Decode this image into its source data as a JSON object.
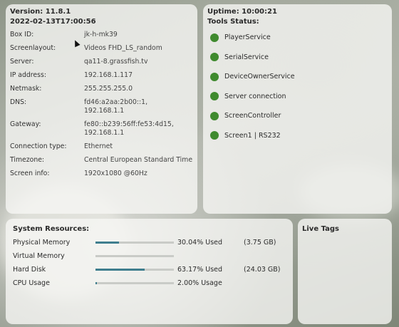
{
  "info": {
    "version": "Version: 11.8.1",
    "timestamp": "2022-02-13T17:00:56",
    "rows": [
      {
        "key": "Box ID:",
        "value": "jk-h-mk39"
      },
      {
        "key": "Screenlayout:",
        "value": "Videos FHD_LS_random"
      },
      {
        "key": "Server:",
        "value": "qa11-8.grassfish.tv"
      },
      {
        "key": "IP address:",
        "value": "192.168.1.117"
      },
      {
        "key": "Netmask:",
        "value": "255.255.255.0"
      },
      {
        "key": "DNS:",
        "value": "fd46:a2aa:2b00::1,\n192.168.1.1"
      },
      {
        "key": "Gateway:",
        "value": "fe80::b239:56ff:fe53:4d15,\n192.168.1.1"
      },
      {
        "key": "Connection type:",
        "value": "Ethernet"
      },
      {
        "key": "Timezone:",
        "value": "Central European Standard Time"
      },
      {
        "key": "Screen info:",
        "value": "1920x1080 @60Hz"
      }
    ]
  },
  "uptime": {
    "title": "Uptime: 10:00:21",
    "tools_label": "Tools Status:",
    "tools": [
      {
        "name": "PlayerService",
        "status_color": "#3f8a2e"
      },
      {
        "name": "SerialService",
        "status_color": "#3f8a2e"
      },
      {
        "name": "DeviceOwnerService",
        "status_color": "#3f8a2e"
      },
      {
        "name": "Server connection",
        "status_color": "#3f8a2e"
      },
      {
        "name": "ScreenController",
        "status_color": "#3f8a2e"
      },
      {
        "name": "Screen1 | RS232",
        "status_color": "#3f8a2e"
      }
    ]
  },
  "resources": {
    "title": "System Resources:",
    "items": [
      {
        "label": "Physical Memory",
        "fraction": 0.3004,
        "used": "30.04% Used",
        "size": "(3.75 GB)"
      },
      {
        "label": "Virtual Memory",
        "fraction": 0,
        "used": "",
        "size": ""
      },
      {
        "label": "Hard Disk",
        "fraction": 0.6317,
        "used": "63.17% Used",
        "size": "(24.03 GB)"
      },
      {
        "label": "CPU Usage",
        "fraction": 0.02,
        "used": "2.00% Usage",
        "size": ""
      }
    ]
  },
  "live_tags": {
    "title": "Live Tags"
  },
  "colors": {
    "status_ok": "#3f8a2e",
    "bar_fill": "#3f7e8e"
  }
}
